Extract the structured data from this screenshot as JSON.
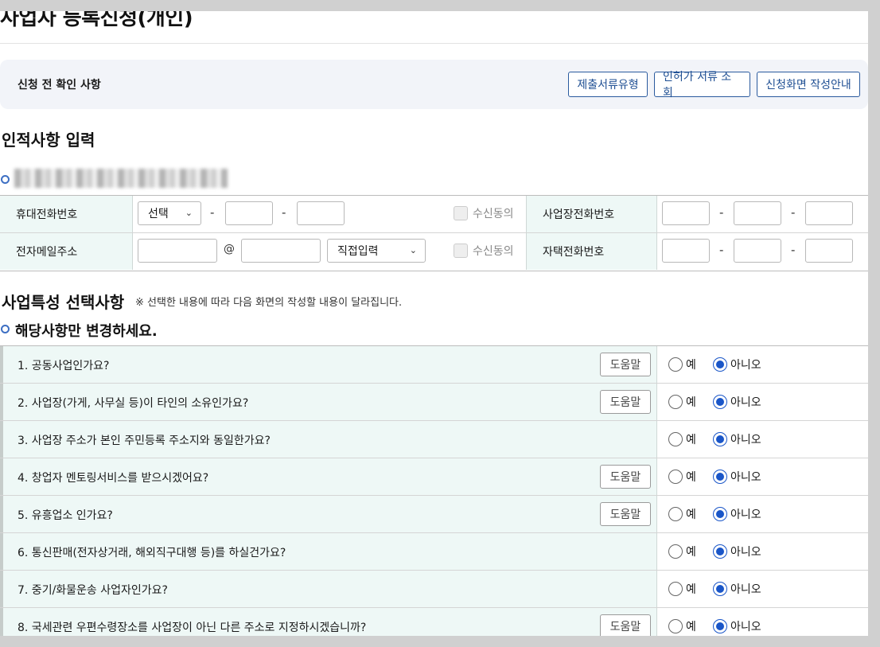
{
  "page": {
    "title": "사업자 등록신청(개인)"
  },
  "precheck": {
    "label": "신청 전 확인 사항",
    "buttons": [
      "제출서류유형",
      "인허가 서류 조회",
      "신청화면 작성안내"
    ]
  },
  "personal": {
    "section_title": "인적사항 입력",
    "rows": {
      "mobile_label": "휴대전화번호",
      "mobile_select": "선택",
      "email_label": "전자메일주소",
      "email_at": "@",
      "email_domain_select": "직접입력",
      "consent_label": "수신동의",
      "biz_phone_label": "사업장전화번호",
      "home_phone_label": "자택전화번호",
      "dash": "-"
    }
  },
  "business": {
    "section_title": "사업특성 선택사항",
    "note": "※ 선택한 내용에 따라 다음 화면의 작성할 내용이 달라집니다.",
    "sub_title": "해당사항만 변경하세요.",
    "help_label": "도움말",
    "yes_label": "예",
    "no_label": "아니오",
    "questions": [
      {
        "text": "1. 공동사업인가요?",
        "has_help": true,
        "answer": "아니오"
      },
      {
        "text": "2. 사업장(가게, 사무실 등)이 타인의 소유인가요?",
        "has_help": true,
        "answer": "아니오"
      },
      {
        "text": "3. 사업장 주소가 본인 주민등록 주소지와 동일한가요?",
        "has_help": false,
        "answer": "아니오"
      },
      {
        "text": "4. 창업자 멘토링서비스를 받으시겠어요?",
        "has_help": true,
        "answer": "아니오"
      },
      {
        "text": "5. 유흥업소 인가요?",
        "has_help": true,
        "answer": "아니오"
      },
      {
        "text": "6. 통신판매(전자상거래, 해외직구대행 등)를 하실건가요?",
        "has_help": false,
        "answer": "아니오"
      },
      {
        "text": "7. 중기/화물운송 사업자인가요?",
        "has_help": false,
        "answer": "아니오"
      },
      {
        "text": "8. 국세관련 우편수령장소를 사업장이 아닌 다른 주소로 지정하시겠습니까?",
        "has_help": true,
        "answer": "아니오"
      }
    ]
  }
}
